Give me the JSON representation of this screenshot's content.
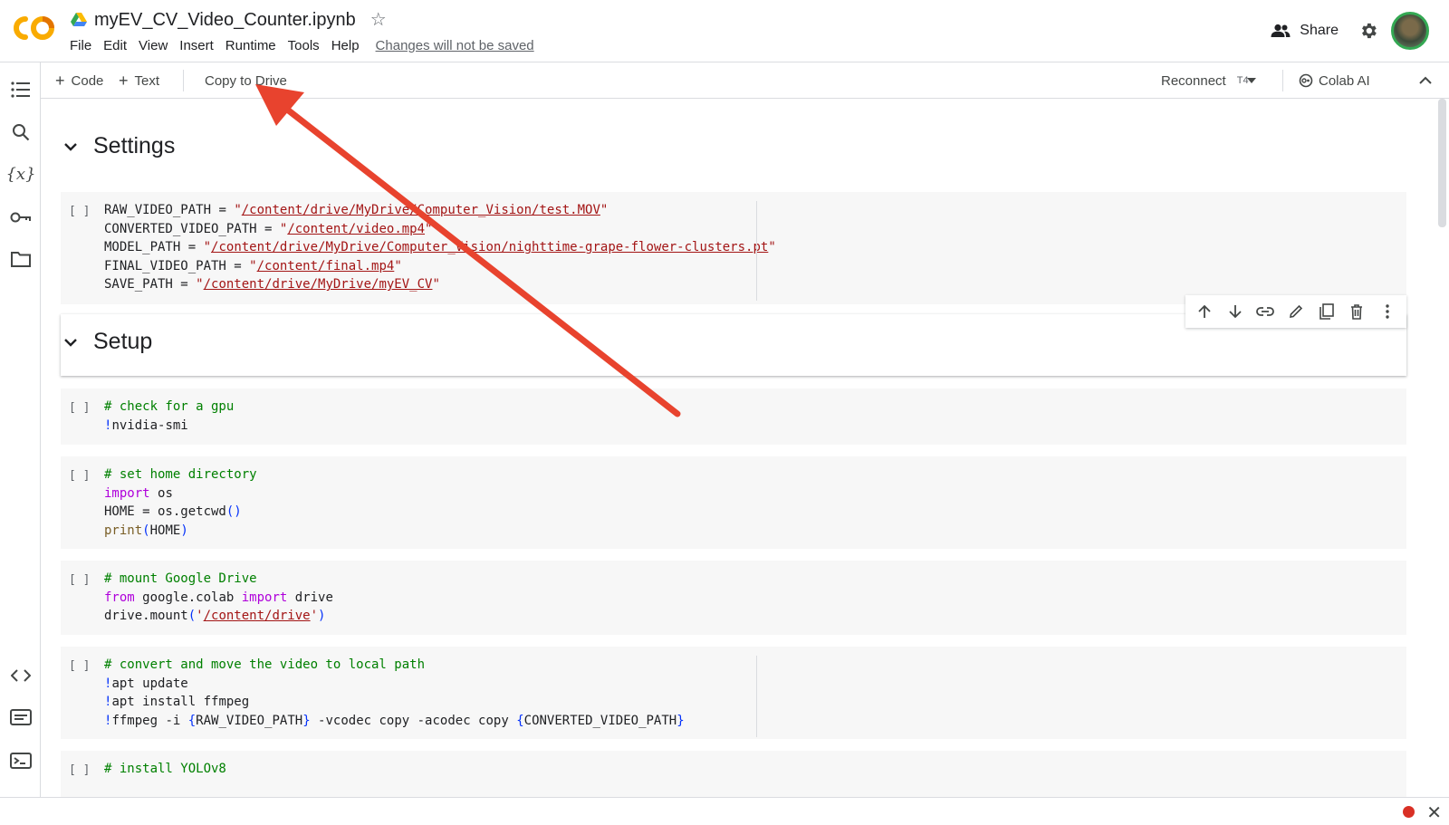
{
  "header": {
    "notebook_title": "myEV_CV_Video_Counter.ipynb",
    "menu": [
      "File",
      "Edit",
      "View",
      "Insert",
      "Runtime",
      "Tools",
      "Help"
    ],
    "changes_notice": "Changes will not be saved",
    "share_label": "Share"
  },
  "toolbar": {
    "code_label": "Code",
    "text_label": "Text",
    "copy_to_drive_label": "Copy to Drive",
    "reconnect_label": "Reconnect",
    "gpu_label": "T4",
    "colab_ai_label": "Colab AI"
  },
  "sections": {
    "settings_title": "Settings",
    "setup_title": "Setup"
  },
  "cells": {
    "run_marker": "[ ]",
    "settings": {
      "lines": [
        {
          "var": "RAW_VIDEO_PATH",
          "value": "/content/drive/MyDrive/Computer_Vision/test.MOV"
        },
        {
          "var": "CONVERTED_VIDEO_PATH",
          "value": "/content/video.mp4"
        },
        {
          "var": "MODEL_PATH",
          "value": "/content/drive/MyDrive/Computer_Vision/nighttime-grape-flower-clusters.pt"
        },
        {
          "var": "FINAL_VIDEO_PATH",
          "value": "/content/final.mp4"
        },
        {
          "var": "SAVE_PATH",
          "value": "/content/drive/MyDrive/myEV_CV"
        }
      ]
    },
    "gpu": {
      "comment": "# check for a gpu",
      "cmd": "nvidia-smi"
    },
    "home": {
      "comment": "# set home directory",
      "import_kw": "import",
      "import_mod": "os",
      "assign": "HOME = os.getcwd",
      "print_fn": "print",
      "print_arg": "HOME"
    },
    "mount": {
      "comment": "# mount Google Drive",
      "from_kw": "from",
      "module": "google.colab",
      "import_kw": "import",
      "name": "drive",
      "call": "drive.mount",
      "path": "/content/drive"
    },
    "convert": {
      "comment": "# convert and move the video to local path",
      "cmd1": "apt update",
      "cmd2": "apt install ffmpeg",
      "cmd3_a": "ffmpeg -i ",
      "cmd3_var1": "RAW_VIDEO_PATH",
      "cmd3_b": " -vcodec copy -acodec copy ",
      "cmd3_var2": "CONVERTED_VIDEO_PATH"
    },
    "yolo": {
      "comment": "# install YOLOv8"
    }
  },
  "icons": {
    "rail": [
      "table-of-contents-icon",
      "search-icon",
      "variables-icon",
      "secrets-key-icon",
      "files-folder-icon",
      "code-snippets-icon",
      "command-palette-icon",
      "terminal-icon"
    ],
    "cell_toolbar": [
      "move-up-icon",
      "move-down-icon",
      "link-icon",
      "edit-icon",
      "mirror-cell-icon",
      "delete-icon",
      "more-options-icon"
    ]
  },
  "colors": {
    "annotation_arrow": "#e8432e",
    "string": "#a31515",
    "comment": "#008000",
    "keyword": "#af00db"
  }
}
